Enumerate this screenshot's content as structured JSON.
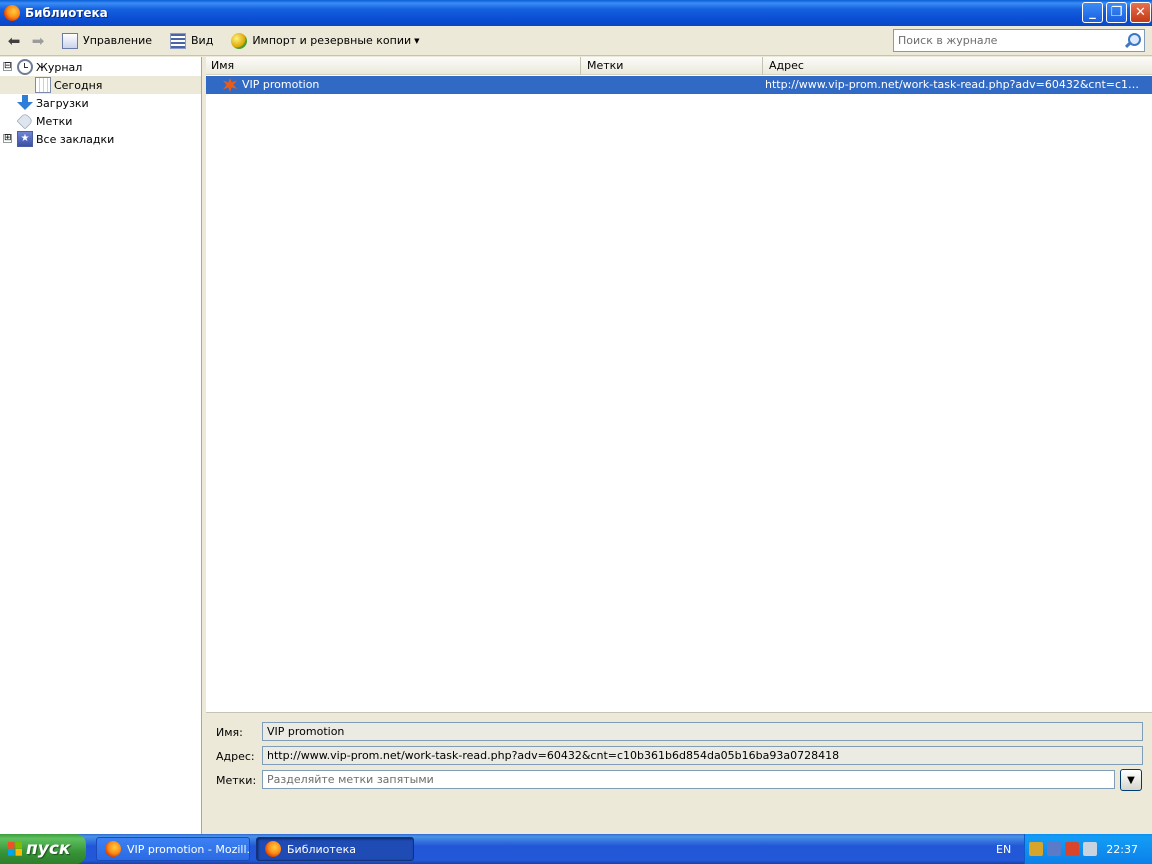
{
  "window": {
    "title": "Библиотека"
  },
  "toolbar": {
    "manage_label": "Управление",
    "view_label": "Вид",
    "import_label": "Импорт и резервные копии",
    "search_placeholder": "Поиск в журнале"
  },
  "tree": {
    "items": [
      {
        "label": "Журнал",
        "icon": "history-clock-icon",
        "expander": "⊟"
      },
      {
        "label": "Сегодня",
        "icon": "calendar-icon"
      },
      {
        "label": "Загрузки",
        "icon": "download-arrow-icon"
      },
      {
        "label": "Метки",
        "icon": "tag-icon"
      },
      {
        "label": "Все закладки",
        "icon": "bookmarks-star-icon",
        "expander": "⊞"
      }
    ]
  },
  "list": {
    "columns": [
      "Имя",
      "Метки",
      "Адрес"
    ],
    "rows": [
      {
        "name": "VIP promotion",
        "tags": "",
        "address": "http://www.vip-prom.net/work-task-read.php?adv=60432&cnt=c10b361b6d854da05b16ba93a0728418"
      }
    ]
  },
  "details": {
    "name_label": "Имя:",
    "name_value": "VIP promotion",
    "address_label": "Адрес:",
    "address_value": "http://www.vip-prom.net/work-task-read.php?adv=60432&cnt=c10b361b6d854da05b16ba93a0728418",
    "tags_label": "Метки:",
    "tags_placeholder": "Разделяйте метки запятыми"
  },
  "taskbar": {
    "start_label": "пуск",
    "tasks": [
      {
        "label": "VIP promotion - Mozill..."
      },
      {
        "label": "Библиотека"
      }
    ],
    "language": "EN",
    "time": "22:37"
  }
}
